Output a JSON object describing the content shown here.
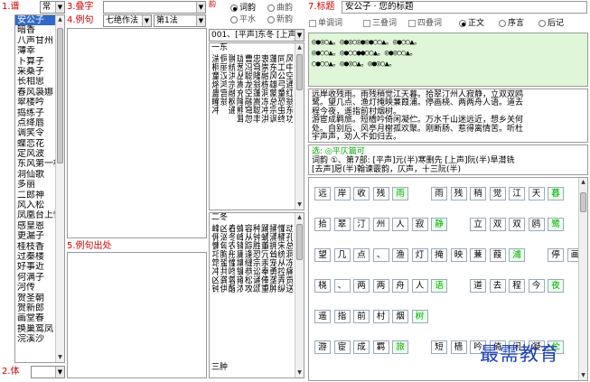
{
  "left": {
    "tune_label": "1.谱",
    "tune_select": "常",
    "tune_list": [
      "安公子",
      "暗香",
      "八声甘州",
      "薄幸",
      "卜算子",
      "采桑子",
      "长相思",
      "春风袅娜",
      "翠楼吟",
      "捣练子",
      "点绛唇",
      "调笑令",
      "蝶恋花",
      "定风波",
      "东风第一枝",
      "洞仙歌",
      "多丽",
      "二郎神",
      "风入松",
      "凤凰台上忆",
      "感皇恩",
      "更漏子",
      "桂枝香",
      "过秦楼",
      "好事近",
      "何满子",
      "河传",
      "贺圣朝",
      "贺新郎",
      "画堂春",
      "换巢鸾凤",
      "浣溪沙"
    ],
    "body_label": "2.体"
  },
  "mid": {
    "char_label": "3.叠字",
    "example_label": "4.例句",
    "method_select": "七绝作法",
    "rule_select": "第1法",
    "source_label": "5.例句出处",
    "rhyme_label": "韵",
    "rhyme_opts": [
      {
        "label": "词韵",
        "on": true
      },
      {
        "label": "曲韵",
        "on": false
      },
      {
        "label": "平水",
        "on": false
      },
      {
        "label": "新韵",
        "on": false
      }
    ],
    "rhyme_select": "001、[平声]东冬 [上声]",
    "section1": "一东",
    "section2": "二冬",
    "section3": "三肿",
    "cols1": [
      "风中空通红翁东功",
      "同工公弓童恐虫终",
      "蓬东风雄蒙总宗讽",
      "衷崇融栋洞冻冲洪",
      "忠穹隆翁蓬嵩聪丰",
      "曹冯聪龙空融穹忽",
      "珑葱丛嵩充隆熊茸",
      "翀统洪宗融枫通",
      "侗丽汉鸿宫翁",
      "湍桐童熔蛊瞳冲"
    ],
    "cols2": [
      "动孔总洞冻痛贡送",
      "懂桶宋统从控弄纵",
      "捅涌拥耸宠勇垄肿",
      "踊蛹董冗汞奉俸重",
      "种钟胜恐宗讼诵颂",
      "容从踪逢缝恭松攻",
      "蜂峰锋庸墉镛雍浓",
      "舂冬农彤憧咚蓉醒",
      "凶汹匈胸蛩共龚供",
      "峰佣慵邛筇冲凶钟"
    ],
    "title_label": "7.标题",
    "title_value": "安公子 · 您的标题",
    "ci_opts": [
      {
        "label": "单调词"
      },
      {
        "label": "三叠词"
      },
      {
        "label": "四叠词"
      }
    ],
    "text_opts": [
      {
        "label": "正文",
        "on": true
      },
      {
        "label": "序言",
        "on": false
      },
      {
        "label": "后记",
        "on": false
      }
    ]
  },
  "right": {
    "pattern_lines": [
      "◎●◎○▲。◎●◎○◎●◎●○○▲。◎●○○▲。",
      "◎●○○▲。◎●○○●●○○▲。◎●◎○○▲。",
      "○●○○▲。◎●◎○▲。◎●◎○▲。"
    ],
    "poem_lines": [
      "远岸收残雨。雨残稍觉江天暮。拾翠汀州人寂静，立双双鸥",
      "鹭。望几点、渔灯掩映蒹葭浦。停画桡、两两舟人语。道去",
      "程今夜，遥指前村烟树。",
      "游宦成羁旅。短樯吟倚闲凝伫。万水千山迷远近，想乡关何",
      "处。自别后、风亭月榭孤欢聚。刚断肠、惹得离情苦。听杜",
      "宇声声，劝人不如归去。"
    ],
    "check_title": "选: ◎平仄篇可",
    "check_line1": "词韵 ①、第7部: [平声]元(半)寒删先 [上声]阮(半)旱潸铣",
    "check_line2": "[去声]愿(半)翰谏霰韵，仄声，十三阮(半)",
    "grid_rows": [
      [
        "远",
        "岸",
        "收",
        "残",
        "雨",
        "",
        "雨",
        "残",
        "稍",
        "觉",
        "江",
        "天",
        "暮"
      ],
      [
        "拾",
        "翠",
        "汀",
        "州",
        "人",
        "寂",
        "静",
        "",
        "立",
        "双",
        "双",
        "鸥",
        "鹭"
      ],
      [
        "望",
        "几",
        "点",
        "、",
        "渔",
        "灯",
        "掩",
        "映",
        "蒹",
        "葭",
        "浦",
        "",
        "停",
        "画"
      ],
      [
        "桡",
        "、",
        "两",
        "两",
        "舟",
        "人",
        "语",
        "",
        "道",
        "去",
        "程",
        "今",
        "夜"
      ],
      [
        "遥",
        "指",
        "前",
        "村",
        "烟",
        "树"
      ],
      [
        "游",
        "宦",
        "成",
        "羁",
        "旅",
        "",
        "短",
        "樯",
        "吟",
        "倚",
        "闲",
        "凝",
        "伫"
      ]
    ],
    "watermark": "最需教育"
  }
}
